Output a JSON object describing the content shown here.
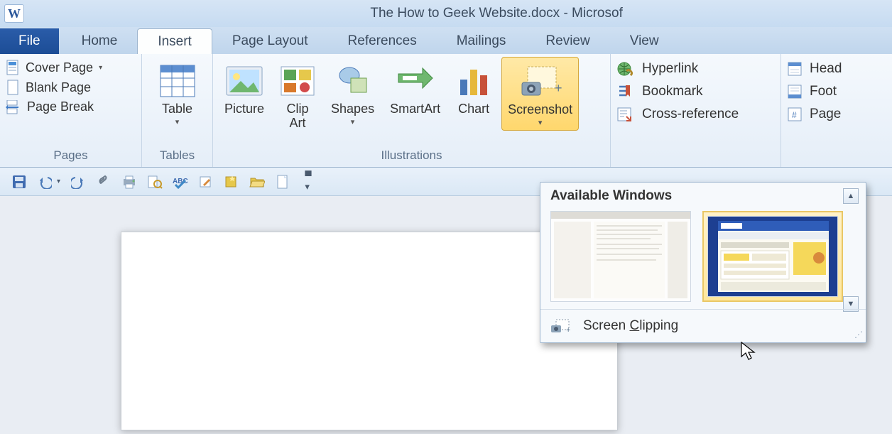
{
  "app": {
    "letter": "W",
    "title": "The How to Geek Website.docx  -  Microsof"
  },
  "tabs": {
    "file": "File",
    "items": [
      "Home",
      "Insert",
      "Page Layout",
      "References",
      "Mailings",
      "Review",
      "View"
    ],
    "active": "Insert"
  },
  "ribbon": {
    "pages": {
      "label": "Pages",
      "cover": "Cover Page",
      "blank": "Blank Page",
      "break": "Page Break"
    },
    "tables": {
      "label": "Tables",
      "table": "Table"
    },
    "illus": {
      "label": "Illustrations",
      "picture": "Picture",
      "clipart_l1": "Clip",
      "clipart_l2": "Art",
      "shapes": "Shapes",
      "smartart": "SmartArt",
      "chart": "Chart",
      "screenshot": "Screenshot"
    },
    "links": {
      "hyperlink": "Hyperlink",
      "bookmark": "Bookmark",
      "crossref": "Cross-reference"
    },
    "headerfooter": {
      "header": "Head",
      "footer": "Foot",
      "pagenum": "Page"
    }
  },
  "dropdown": {
    "title": "Available Windows",
    "screen_clipping_pre": "Screen ",
    "screen_clipping_u": "C",
    "screen_clipping_post": "lipping"
  }
}
